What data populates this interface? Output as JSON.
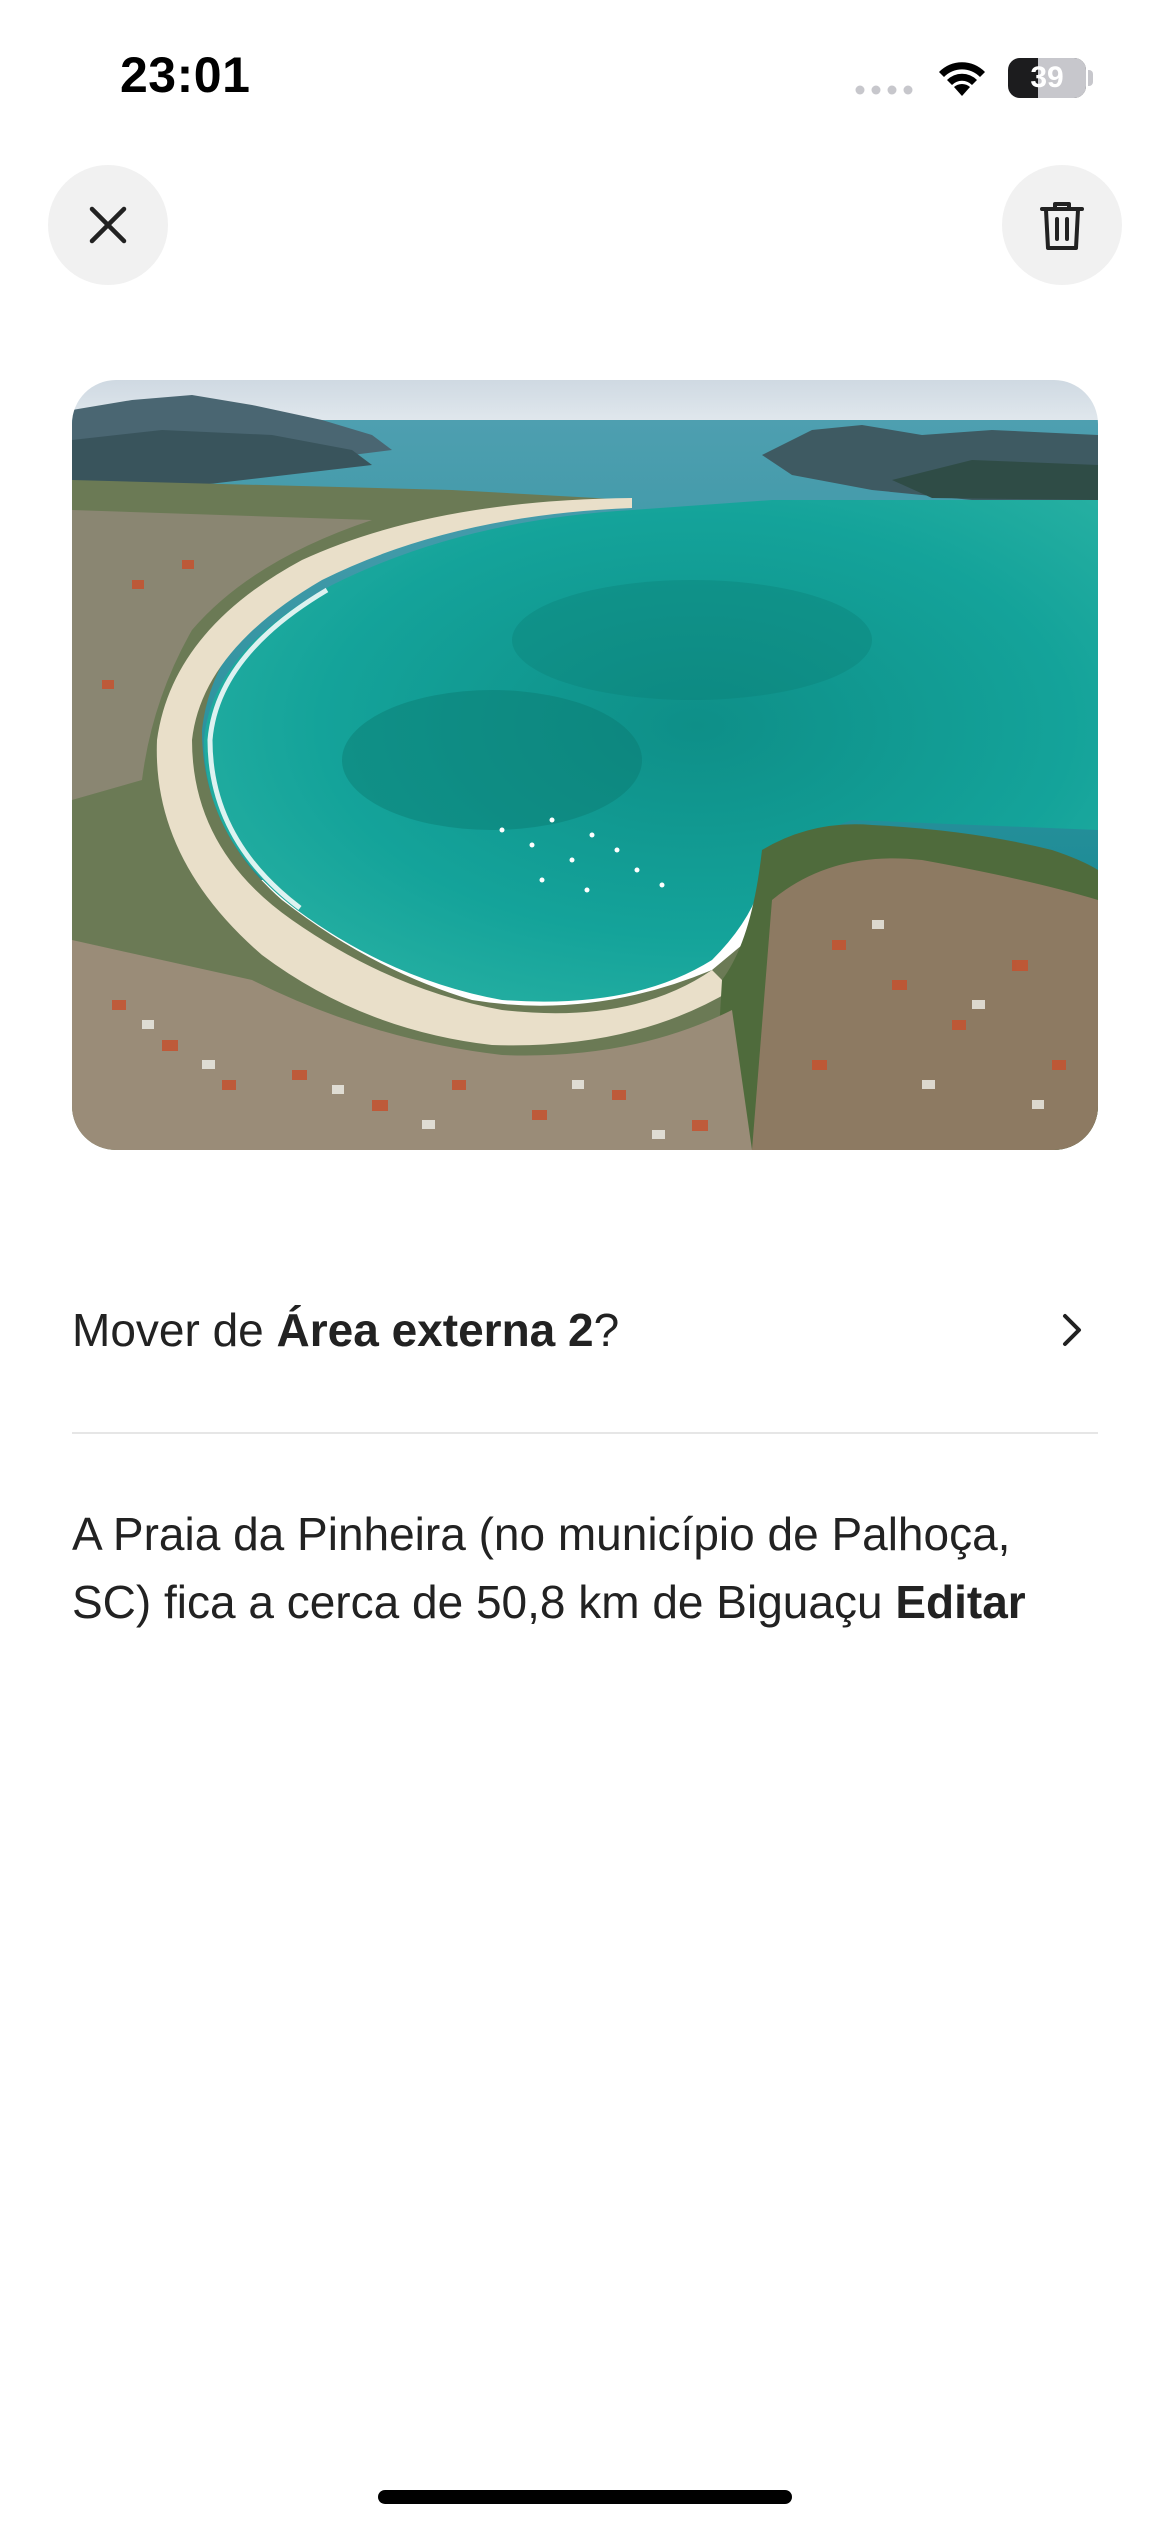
{
  "status_bar": {
    "time": "23:01",
    "battery": "39",
    "battery_level": 0.39
  },
  "header": {
    "close_icon": "close-icon",
    "delete_icon": "trash-icon"
  },
  "photo": {
    "subject": "aerial-beach-photo"
  },
  "move_row": {
    "prefix": "Mover de ",
    "area_name": "Área externa 2",
    "suffix": "?",
    "icon": "chevron-right-icon"
  },
  "description": {
    "text": "A Praia da Pinheira (no município de Palhoça, SC) fica a cerca de 50,8 km de Biguaçu ",
    "edit_label": "Editar"
  },
  "colors": {
    "text": "#222222",
    "button_bg": "#f1f1f1",
    "divider": "#e6e6e6"
  }
}
